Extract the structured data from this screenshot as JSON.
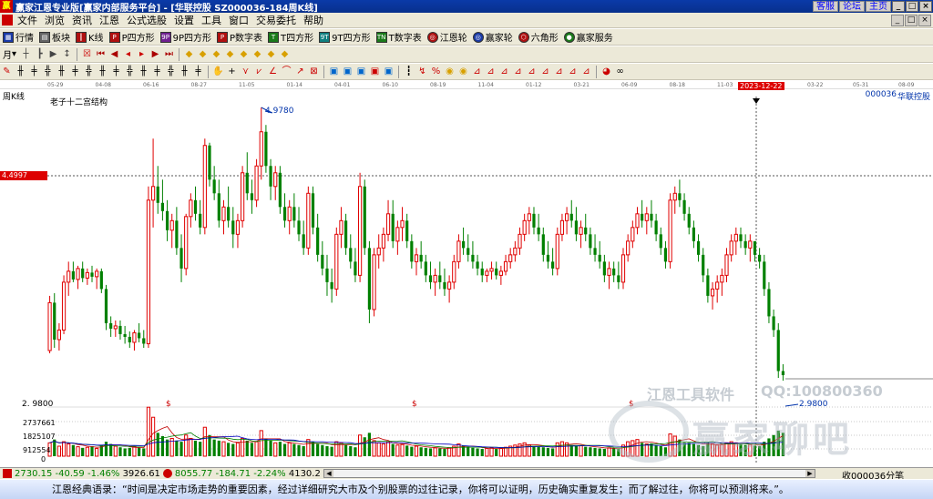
{
  "window": {
    "title": "赢家江恩专业版[赢家内部服务平台] - [华联控股  SZ000036-184周K线]",
    "links": [
      "客服",
      "论坛",
      "主页"
    ],
    "win_buttons": [
      "_",
      "□",
      "×"
    ]
  },
  "menu": {
    "items": [
      "文件",
      "浏览",
      "资讯",
      "江恩",
      "公式选股",
      "设置",
      "工具",
      "窗口",
      "交易委托",
      "帮助"
    ],
    "right_buttons": [
      "_",
      "□",
      "×"
    ]
  },
  "toolbar1": {
    "items": [
      {
        "label": "行情",
        "icon": "quote-icon",
        "glyph": "▦"
      },
      {
        "label": "板块",
        "icon": "sector-icon",
        "glyph": "▤"
      },
      {
        "label": "K线",
        "icon": "kline-icon",
        "glyph": "┃"
      },
      {
        "label": "P四方形",
        "icon": "p-square-icon",
        "glyph": "P"
      },
      {
        "label": "9P四方形",
        "icon": "9p-square-icon",
        "glyph": "9P"
      },
      {
        "label": "P数字表",
        "icon": "p-numtable-icon",
        "glyph": "P"
      },
      {
        "label": "T四方形",
        "icon": "t-square-icon",
        "glyph": "T"
      },
      {
        "label": "9T四方形",
        "icon": "9t-square-icon",
        "glyph": "9T"
      },
      {
        "label": "T数字表",
        "icon": "t-numtable-icon",
        "glyph": "TN"
      },
      {
        "label": "江恩轮",
        "icon": "gann-wheel-icon",
        "glyph": "◎"
      },
      {
        "label": "赢家轮",
        "icon": "winner-wheel-icon",
        "glyph": "◎"
      },
      {
        "label": "六角形",
        "icon": "hexagon-icon",
        "glyph": "⬡"
      },
      {
        "label": "赢家服务",
        "icon": "service-icon",
        "glyph": "●"
      }
    ]
  },
  "toolbar2": {
    "period": "月",
    "icons": [
      "chart-type-icon",
      "bar-type-icon",
      "play-type-icon",
      "period-icon",
      "zoom-icon",
      "first-icon",
      "prev-page-icon",
      "prev-icon",
      "next-icon",
      "next-page-icon",
      "last-icon",
      "diamond1-icon",
      "diamond2-icon",
      "diamond3-icon",
      "diamond4-icon",
      "diamond5-icon",
      "diamond6-icon",
      "diamond7-icon",
      "diamond8-icon"
    ]
  },
  "toolbar3": {
    "icons": [
      "pen-icon",
      "bars1-icon",
      "bars2-icon",
      "bars3-icon",
      "bars4-icon",
      "bars5-icon",
      "bars6-icon",
      "bars7-icon",
      "bars8-icon",
      "bars9-icon",
      "bars10-icon",
      "bars11-icon",
      "bars12-icon",
      "bars13-icon",
      "bars14-icon",
      "hand-icon",
      "crosshair-icon",
      "line-tool-icon",
      "fan-tool-icon",
      "angle-tool-icon",
      "arc-tool-icon",
      "ray-tool-icon",
      "box-tool-icon",
      "save1-icon",
      "save2-icon",
      "save3-icon",
      "save4-icon",
      "save5-icon",
      "rule1-icon",
      "rule2-icon",
      "percent-icon",
      "circle1-icon",
      "circle2-icon",
      "tri1-icon",
      "tri2-icon",
      "tri3-icon",
      "tri4-icon",
      "tri5-icon",
      "tri6-icon",
      "tri7-icon",
      "tri8-icon",
      "tri9-icon",
      "pie-icon",
      "infinity-icon"
    ]
  },
  "date_axis": {
    "ticks": [
      "05-29",
      "04-08",
      "06-16",
      "08-27",
      "11-05",
      "01-14",
      "04-01",
      "06-10",
      "08-19",
      "11-04",
      "01-12",
      "03-21",
      "06-09",
      "08-18",
      "11-03"
    ],
    "highlight": "2023-12-22",
    "after": [
      "03-22",
      "05-31",
      "08-09"
    ]
  },
  "chart": {
    "period_label": "周K线",
    "indicator": "老子十二宫结构",
    "stock_code": "000036",
    "stock_name": "华联控股",
    "crosshair_price": "4.4997",
    "high_label": "4.9780",
    "low_label": "2.9800",
    "axis_low": "2. 9800",
    "volume_labels": [
      "2737661",
      "1825107",
      "912554",
      "0"
    ],
    "watermark_line": "江恩工具软件",
    "watermark_qq": "QQ:100800360",
    "watermark_big": "赢家聊吧"
  },
  "chart_data": {
    "type": "candlestick",
    "ylim": [
      2.98,
      4.978
    ],
    "high": 4.978,
    "low": 2.98,
    "crosshair": 4.4997,
    "ohlc": [
      [
        3.2,
        3.6,
        3.18,
        3.55
      ],
      [
        3.55,
        3.62,
        3.22,
        3.28
      ],
      [
        3.28,
        3.4,
        3.2,
        3.35
      ],
      [
        3.35,
        3.75,
        3.32,
        3.7
      ],
      [
        3.7,
        3.85,
        3.6,
        3.78
      ],
      [
        3.78,
        3.85,
        3.7,
        3.72
      ],
      [
        3.72,
        3.82,
        3.65,
        3.8
      ],
      [
        3.8,
        3.85,
        3.7,
        3.73
      ],
      [
        3.73,
        3.8,
        3.68,
        3.77
      ],
      [
        3.77,
        3.82,
        3.7,
        3.74
      ],
      [
        3.74,
        3.8,
        3.65,
        3.78
      ],
      [
        3.78,
        3.8,
        3.62,
        3.65
      ],
      [
        3.65,
        3.68,
        3.35,
        3.4
      ],
      [
        3.4,
        3.45,
        3.3,
        3.36
      ],
      [
        3.36,
        3.42,
        3.3,
        3.38
      ],
      [
        3.38,
        3.42,
        3.28,
        3.32
      ],
      [
        3.32,
        3.38,
        3.25,
        3.3
      ],
      [
        3.3,
        3.34,
        3.22,
        3.26
      ],
      [
        3.26,
        3.35,
        3.2,
        3.33
      ],
      [
        3.33,
        3.4,
        3.26,
        3.29
      ],
      [
        3.29,
        3.35,
        3.22,
        3.25
      ],
      [
        3.25,
        4.4,
        3.22,
        4.3
      ],
      [
        4.3,
        4.75,
        4.1,
        4.4
      ],
      [
        4.4,
        4.55,
        4.2,
        4.28
      ],
      [
        4.28,
        4.45,
        4.15,
        4.22
      ],
      [
        4.22,
        4.3,
        4.0,
        4.08
      ],
      [
        4.08,
        4.2,
        3.95,
        4.15
      ],
      [
        4.15,
        4.25,
        3.9,
        3.95
      ],
      [
        3.95,
        4.05,
        3.7,
        3.8
      ],
      [
        3.8,
        4.2,
        3.75,
        4.18
      ],
      [
        4.18,
        4.35,
        4.1,
        4.3
      ],
      [
        4.3,
        4.4,
        4.15,
        4.2
      ],
      [
        4.2,
        4.3,
        4.05,
        4.1
      ],
      [
        4.1,
        4.75,
        4.05,
        4.7
      ],
      [
        4.7,
        4.72,
        4.4,
        4.45
      ],
      [
        4.45,
        4.55,
        4.3,
        4.35
      ],
      [
        4.35,
        4.45,
        4.1,
        4.15
      ],
      [
        4.15,
        4.3,
        4.05,
        4.25
      ],
      [
        4.25,
        4.4,
        4.1,
        4.15
      ],
      [
        4.15,
        4.25,
        3.95,
        4.05
      ],
      [
        4.05,
        4.2,
        3.95,
        4.15
      ],
      [
        4.15,
        4.55,
        4.1,
        4.5
      ],
      [
        4.5,
        4.65,
        4.3,
        4.35
      ],
      [
        4.35,
        4.45,
        4.2,
        4.3
      ],
      [
        4.3,
        4.6,
        4.25,
        4.55
      ],
      [
        4.55,
        4.978,
        4.45,
        4.8
      ],
      [
        4.8,
        4.85,
        4.5,
        4.55
      ],
      [
        4.55,
        4.6,
        4.3,
        4.4
      ],
      [
        4.4,
        4.55,
        4.3,
        4.5
      ],
      [
        4.5,
        4.55,
        4.2,
        4.25
      ],
      [
        4.25,
        4.35,
        4.1,
        4.15
      ],
      [
        4.15,
        4.3,
        4.05,
        4.25
      ],
      [
        4.25,
        4.35,
        4.1,
        4.15
      ],
      [
        4.15,
        4.25,
        4.0,
        4.05
      ],
      [
        4.05,
        4.15,
        3.9,
        3.95
      ],
      [
        3.95,
        4.4,
        3.9,
        4.35
      ],
      [
        4.35,
        4.4,
        4.05,
        4.1
      ],
      [
        4.1,
        4.2,
        3.85,
        3.9
      ],
      [
        3.9,
        4.0,
        3.75,
        3.8
      ],
      [
        3.8,
        3.9,
        3.6,
        3.7
      ],
      [
        3.7,
        3.8,
        3.55,
        3.65
      ],
      [
        3.65,
        4.1,
        3.6,
        4.05
      ],
      [
        4.05,
        4.25,
        3.95,
        4.15
      ],
      [
        4.15,
        4.2,
        3.9,
        3.95
      ],
      [
        3.95,
        4.05,
        3.8,
        3.85
      ],
      [
        3.85,
        3.95,
        3.7,
        3.75
      ],
      [
        3.75,
        4.5,
        3.7,
        4.4
      ],
      [
        4.4,
        4.45,
        3.9,
        3.95
      ],
      [
        3.95,
        4.0,
        3.4,
        3.5
      ],
      [
        3.5,
        3.95,
        3.45,
        3.9
      ],
      [
        3.9,
        4.05,
        3.8,
        3.95
      ],
      [
        3.95,
        4.1,
        3.85,
        4.05
      ],
      [
        4.05,
        4.3,
        4.0,
        4.2
      ],
      [
        4.2,
        4.3,
        3.95,
        4.0
      ],
      [
        4.0,
        4.15,
        3.9,
        4.1
      ],
      [
        4.1,
        4.25,
        4.0,
        4.15
      ],
      [
        4.15,
        4.2,
        3.95,
        4.0
      ],
      [
        4.0,
        4.05,
        3.8,
        3.85
      ],
      [
        3.85,
        3.95,
        3.75,
        3.9
      ],
      [
        3.9,
        4.0,
        3.8,
        3.85
      ],
      [
        3.85,
        3.9,
        3.7,
        3.75
      ],
      [
        3.75,
        3.85,
        3.65,
        3.7
      ],
      [
        3.7,
        3.8,
        3.6,
        3.75
      ],
      [
        3.75,
        3.85,
        3.65,
        3.7
      ],
      [
        3.7,
        3.8,
        3.6,
        3.65
      ],
      [
        3.65,
        3.75,
        3.55,
        3.7
      ],
      [
        3.7,
        3.9,
        3.65,
        3.85
      ],
      [
        3.85,
        4.05,
        3.8,
        4.0
      ],
      [
        4.0,
        4.1,
        3.9,
        3.95
      ],
      [
        3.95,
        4.05,
        3.85,
        3.9
      ],
      [
        3.9,
        4.0,
        3.8,
        3.85
      ],
      [
        3.85,
        3.9,
        3.75,
        3.8
      ],
      [
        3.8,
        3.85,
        3.7,
        3.75
      ],
      [
        3.75,
        3.8,
        3.7,
        3.78
      ],
      [
        3.78,
        3.85,
        3.72,
        3.8
      ],
      [
        3.8,
        3.85,
        3.72,
        3.75
      ],
      [
        3.75,
        3.82,
        3.68,
        3.78
      ],
      [
        3.78,
        3.9,
        3.75,
        3.85
      ],
      [
        3.85,
        3.95,
        3.8,
        3.9
      ],
      [
        3.9,
        4.0,
        3.85,
        3.95
      ],
      [
        3.95,
        4.1,
        3.9,
        4.05
      ],
      [
        4.05,
        4.2,
        4.0,
        4.15
      ],
      [
        4.15,
        4.25,
        4.05,
        4.2
      ],
      [
        4.2,
        4.25,
        4.05,
        4.1
      ],
      [
        4.1,
        4.2,
        4.0,
        4.05
      ],
      [
        4.05,
        4.1,
        3.85,
        3.9
      ],
      [
        3.9,
        4.0,
        3.8,
        3.85
      ],
      [
        3.85,
        3.95,
        3.75,
        3.8
      ],
      [
        3.8,
        4.1,
        3.75,
        4.05
      ],
      [
        4.05,
        4.2,
        4.0,
        4.15
      ],
      [
        4.15,
        4.25,
        4.05,
        4.2
      ],
      [
        4.2,
        4.3,
        4.1,
        4.15
      ],
      [
        4.15,
        4.25,
        4.0,
        4.05
      ],
      [
        4.05,
        4.15,
        3.95,
        4.1
      ],
      [
        4.1,
        4.2,
        4.0,
        4.05
      ],
      [
        4.05,
        4.1,
        3.9,
        3.95
      ],
      [
        3.95,
        4.05,
        3.85,
        3.9
      ],
      [
        3.9,
        4.0,
        3.8,
        3.85
      ],
      [
        3.85,
        3.9,
        3.7,
        3.75
      ],
      [
        3.75,
        3.85,
        3.65,
        3.8
      ],
      [
        3.8,
        3.85,
        3.7,
        3.75
      ],
      [
        3.75,
        3.85,
        3.65,
        3.7
      ],
      [
        3.7,
        3.95,
        3.65,
        3.9
      ],
      [
        3.9,
        4.05,
        3.85,
        4.0
      ],
      [
        4.0,
        4.15,
        3.95,
        4.1
      ],
      [
        4.1,
        4.25,
        4.05,
        4.2
      ],
      [
        4.2,
        4.3,
        4.1,
        4.15
      ],
      [
        4.15,
        4.25,
        4.05,
        4.2
      ],
      [
        4.2,
        4.3,
        4.1,
        4.15
      ],
      [
        4.15,
        4.2,
        4.0,
        4.05
      ],
      [
        4.05,
        4.1,
        3.9,
        3.95
      ],
      [
        3.95,
        4.0,
        3.8,
        3.85
      ],
      [
        3.85,
        4.35,
        3.8,
        4.3
      ],
      [
        4.3,
        4.4,
        4.2,
        4.35
      ],
      [
        4.35,
        4.45,
        4.25,
        4.3
      ],
      [
        4.3,
        4.35,
        4.15,
        4.2
      ],
      [
        4.2,
        4.25,
        4.05,
        4.1
      ],
      [
        4.1,
        4.15,
        3.95,
        4.0
      ],
      [
        4.0,
        4.05,
        3.85,
        3.9
      ],
      [
        3.9,
        3.95,
        3.7,
        3.75
      ],
      [
        3.75,
        3.8,
        3.55,
        3.6
      ],
      [
        3.6,
        3.7,
        3.5,
        3.65
      ],
      [
        3.65,
        3.75,
        3.55,
        3.7
      ],
      [
        3.7,
        3.8,
        3.6,
        3.75
      ],
      [
        3.75,
        3.95,
        3.7,
        3.9
      ],
      [
        3.9,
        4.05,
        3.85,
        4.0
      ],
      [
        4.0,
        4.1,
        3.9,
        4.05
      ],
      [
        4.05,
        4.1,
        3.95,
        4.0
      ],
      [
        4.0,
        4.05,
        3.9,
        3.95
      ],
      [
        3.95,
        4.05,
        3.85,
        4.0
      ],
      [
        4.0,
        3.98,
        3.85,
        3.9
      ],
      [
        3.9,
        3.95,
        3.8,
        3.85
      ],
      [
        3.85,
        3.9,
        3.6,
        3.65
      ],
      [
        3.65,
        3.7,
        3.4,
        3.45
      ],
      [
        3.45,
        3.5,
        3.3,
        3.35
      ],
      [
        3.35,
        3.4,
        3.0,
        3.05
      ],
      [
        3.05,
        3.1,
        2.98,
        3.02
      ]
    ],
    "volume": [
      240,
      300,
      180,
      260,
      220,
      200,
      170,
      150,
      160,
      180,
      140,
      200,
      260,
      220,
      180,
      160,
      140,
      150,
      170,
      160,
      140,
      880,
      700,
      420,
      360,
      300,
      320,
      280,
      260,
      380,
      320,
      280,
      260,
      520,
      380,
      300,
      280,
      260,
      240,
      220,
      240,
      320,
      280,
      240,
      260,
      460,
      320,
      280,
      240,
      260,
      220,
      240,
      220,
      200,
      180,
      300,
      260,
      220,
      200,
      180,
      170,
      260,
      240,
      200,
      180,
      160,
      380,
      340,
      420,
      280,
      240,
      220,
      260,
      220,
      200,
      210,
      190,
      170,
      180,
      160,
      150,
      140,
      150,
      140,
      130,
      150,
      180,
      220,
      190,
      170,
      150,
      140,
      130,
      140,
      150,
      130,
      140,
      160,
      180,
      200,
      220,
      240,
      200,
      180,
      170,
      160,
      150,
      140,
      240,
      260,
      240,
      200,
      180,
      190,
      170,
      160,
      150,
      140,
      130,
      150,
      140,
      130,
      200,
      260,
      280,
      300,
      240,
      220,
      230,
      200,
      180,
      160,
      400,
      360,
      300,
      260,
      240,
      220,
      200,
      180,
      240,
      220,
      200,
      210,
      240,
      260,
      240,
      220,
      200,
      210,
      190,
      180,
      260,
      320,
      380,
      460,
      420
    ],
    "ma_lines": [
      {
        "name": "ma1",
        "color": "#c00000"
      },
      {
        "name": "ma2",
        "color": "#008000"
      },
      {
        "name": "ma3",
        "color": "#0000c0"
      }
    ],
    "colors": {
      "up": "#e00000",
      "down": "#008000",
      "grid": "#c0c0c0"
    }
  },
  "statusbar": {
    "sh_index": "2730.15",
    "sh_change": "-40.59",
    "sh_pct": "-1.46%",
    "sh_amount": "3926.61",
    "sz_index": "8055.77",
    "sz_change": "-184.71",
    "sz_pct": "-2.24%",
    "sz_amount": "4130.2",
    "right_text": "收000036分笔"
  },
  "quote": {
    "text": "江恩经典语录：“时间是决定市场走势的重要因素，经过详细研究大市及个别股票的过往记录，你将可以证明，历史确实重复发生；而了解过往，你将可以预测将来。”。"
  }
}
